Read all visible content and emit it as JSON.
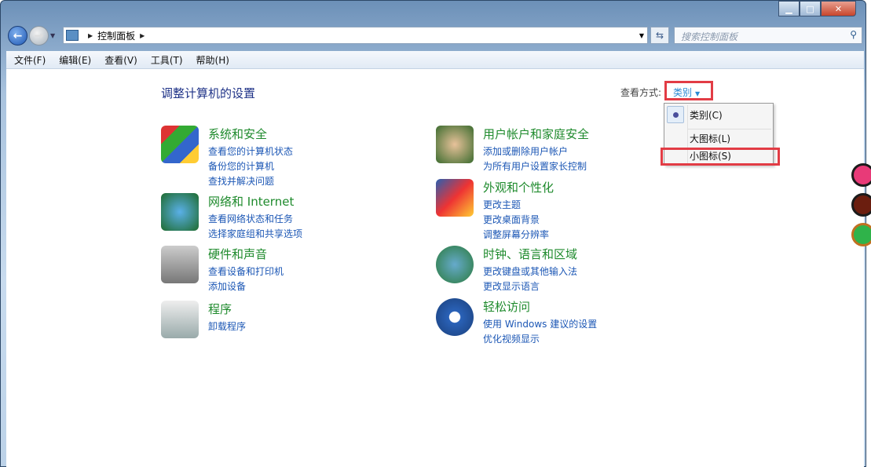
{
  "window": {
    "buttons": [
      "minimize",
      "maximize",
      "close"
    ]
  },
  "address": {
    "path": "控制面板",
    "search_placeholder": "搜索控制面板"
  },
  "menubar": [
    "文件(F)",
    "编辑(E)",
    "查看(V)",
    "工具(T)",
    "帮助(H)"
  ],
  "main": {
    "title": "调整计算机的设置",
    "view_by_label": "查看方式:",
    "view_by_value": "类别",
    "view_menu": [
      {
        "label": "类别(C)",
        "selected": true
      },
      {
        "label": "大图标(L)",
        "selected": false
      },
      {
        "label": "小图标(S)",
        "selected": false
      }
    ],
    "categories": [
      {
        "title": "系统和安全",
        "links": [
          "查看您的计算机状态",
          "备份您的计算机",
          "查找并解决问题"
        ],
        "icon": "shield-icon"
      },
      {
        "title": "网络和 Internet",
        "links": [
          "查看网络状态和任务",
          "选择家庭组和共享选项"
        ],
        "icon": "network-icon"
      },
      {
        "title": "硬件和声音",
        "links": [
          "查看设备和打印机",
          "添加设备"
        ],
        "icon": "printer-icon"
      },
      {
        "title": "程序",
        "links": [
          "卸载程序"
        ],
        "icon": "programs-icon"
      },
      {
        "title": "用户帐户和家庭安全",
        "links": [
          "添加或删除用户帐户",
          "为所有用户设置家长控制"
        ],
        "icon": "users-icon"
      },
      {
        "title": "外观和个性化",
        "links": [
          "更改主题",
          "更改桌面背景",
          "调整屏幕分辨率"
        ],
        "icon": "display-icon"
      },
      {
        "title": "时钟、语言和区域",
        "links": [
          "更改键盘或其他输入法",
          "更改显示语言"
        ],
        "icon": "globe-clock-icon"
      },
      {
        "title": "轻松访问",
        "links": [
          "使用 Windows 建议的设置",
          "优化视频显示"
        ],
        "icon": "ease-of-access-icon"
      }
    ]
  },
  "colors": {
    "highlight": "#e23c45",
    "link": "#1c57b5",
    "category": "#1e8a2c"
  }
}
